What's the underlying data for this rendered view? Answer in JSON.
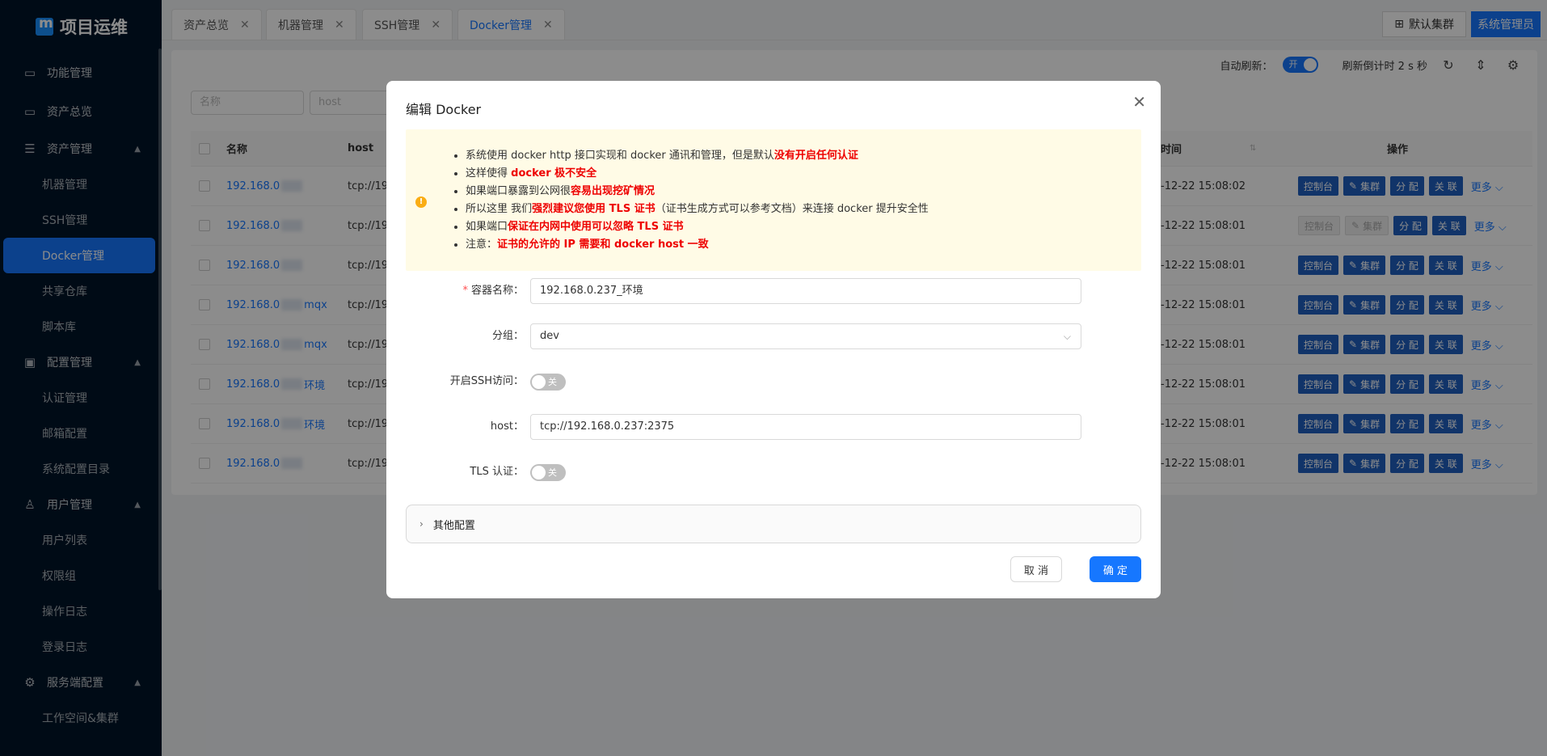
{
  "sidebar": {
    "logo": "项目运维",
    "item_func": "功能管理",
    "item_overview": "资产总览",
    "group_asset": "资产管理",
    "asset_items": [
      "机器管理",
      "SSH管理",
      "Docker管理",
      "共享仓库",
      "脚本库"
    ],
    "group_config": "配置管理",
    "config_items": [
      "认证管理",
      "邮箱配置",
      "系统配置目录"
    ],
    "group_user": "用户管理",
    "user_items": [
      "用户列表",
      "权限组",
      "操作日志",
      "登录日志"
    ],
    "group_server": "服务端配置",
    "server_items": [
      "工作空间&集群"
    ]
  },
  "tabs": [
    "资产总览",
    "机器管理",
    "SSH管理",
    "Docker管理"
  ],
  "header": {
    "cluster_button": "默认集群",
    "admin_button": "系统管理员"
  },
  "toolbar": {
    "auto_refresh_label": "自动刷新：",
    "auto_refresh_value": "开",
    "countdown": "刷新倒计时 2 s 秒"
  },
  "filters": {
    "name_placeholder": "名称",
    "host_placeholder": "host"
  },
  "table": {
    "col_name": "名称",
    "col_host": "host",
    "col_time": "时间",
    "col_actions": "操作",
    "rows": [
      {
        "name": "192.168.0",
        "suffix": "",
        "host": "tcp://19",
        "time": "-12-22 15:08:02",
        "disabled": false
      },
      {
        "name": "192.168.0",
        "suffix": "",
        "host": "tcp://19",
        "time": "-12-22 15:08:01",
        "disabled": true
      },
      {
        "name": "192.168.0",
        "suffix": "",
        "host": "tcp://19",
        "time": "-12-22 15:08:01",
        "disabled": false
      },
      {
        "name": "192.168.0",
        "suffix": "mqx",
        "host": "tcp://19",
        "time": "-12-22 15:08:01",
        "disabled": false
      },
      {
        "name": "192.168.0",
        "suffix": "mqx",
        "host": "tcp://19",
        "time": "-12-22 15:08:01",
        "disabled": false
      },
      {
        "name": "192.168.0",
        "suffix": "环境",
        "host": "tcp://19",
        "time": "-12-22 15:08:01",
        "disabled": false
      },
      {
        "name": "192.168.0",
        "suffix": "环境",
        "host": "tcp://19",
        "time": "-12-22 15:08:01",
        "disabled": false
      },
      {
        "name": "192.168.0",
        "suffix": "",
        "host": "tcp://19",
        "time": "-12-22 15:08:01",
        "disabled": false
      }
    ],
    "actions": {
      "console": "控制台",
      "cluster": "集群",
      "assign": "分 配",
      "relate": "关 联",
      "more": "更多"
    }
  },
  "modal": {
    "title": "编辑 Docker",
    "notice": {
      "l1_a": "系统使用 docker http 接口实现和 docker 通讯和管理，但是默认",
      "l1_b": "没有开启任何认证",
      "l2_a": "这样使得 ",
      "l2_b": "docker 极不安全",
      "l3_a": "如果端口暴露到公网很",
      "l3_b": "容易出现挖矿情况",
      "l4_a": "所以这里 我们",
      "l4_b": "强烈建议您使用 TLS 证书",
      "l4_c": "（证书生成方式可以参考文档）来连接 docker 提升安全性",
      "l5_a": "如果端口",
      "l5_b": "保证在内网中使用可以忽略 TLS 证书",
      "l6_a": "注意：",
      "l6_b": "证书的允许的 IP 需要和 docker host 一致"
    },
    "form": {
      "name_label": "容器名称：",
      "name_value": "192.168.0.237_环境",
      "group_label": "分组：",
      "group_value": "dev",
      "ssh_label": "开启SSH访问：",
      "ssh_value": "关",
      "host_label": "host：",
      "host_value": "tcp://192.168.0.237:2375",
      "tls_label": "TLS 认证：",
      "tls_value": "关"
    },
    "other_config": "其他配置",
    "cancel": "取 消",
    "ok": "确 定"
  }
}
